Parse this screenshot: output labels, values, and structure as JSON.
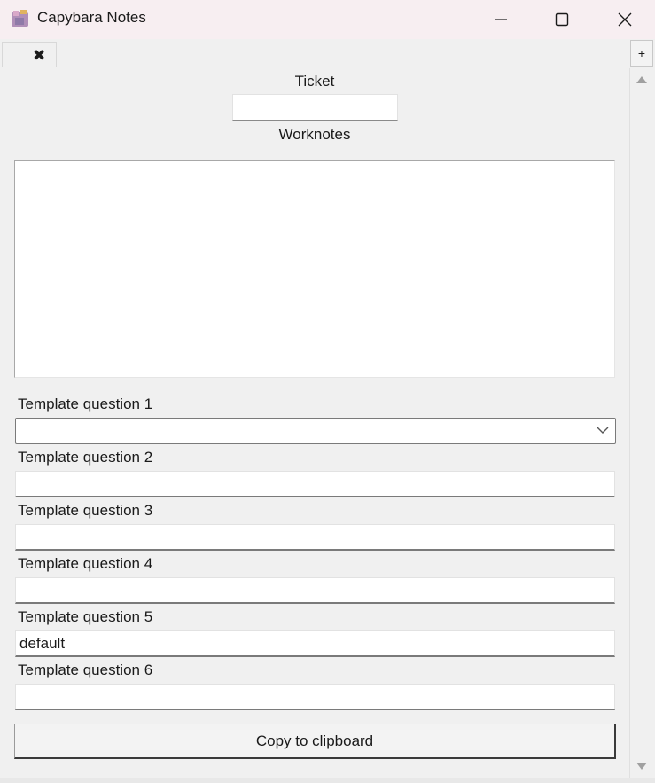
{
  "window": {
    "title": "Capybara Notes",
    "icon": "capybara-app-icon"
  },
  "tabs": {
    "close_glyph": "✖",
    "add_label": "+"
  },
  "form": {
    "ticket_label": "Ticket",
    "ticket_value": "",
    "worknotes_label": "Worknotes",
    "worknotes_value": "",
    "questions": [
      {
        "label": "Template question 1",
        "value": "",
        "kind": "dropdown"
      },
      {
        "label": "Template question 2",
        "value": ""
      },
      {
        "label": "Template question 3",
        "value": ""
      },
      {
        "label": "Template question 4",
        "value": ""
      },
      {
        "label": "Template question 5",
        "value": "default"
      },
      {
        "label": "Template question 6",
        "value": ""
      }
    ],
    "copy_button": "Copy to clipboard"
  }
}
